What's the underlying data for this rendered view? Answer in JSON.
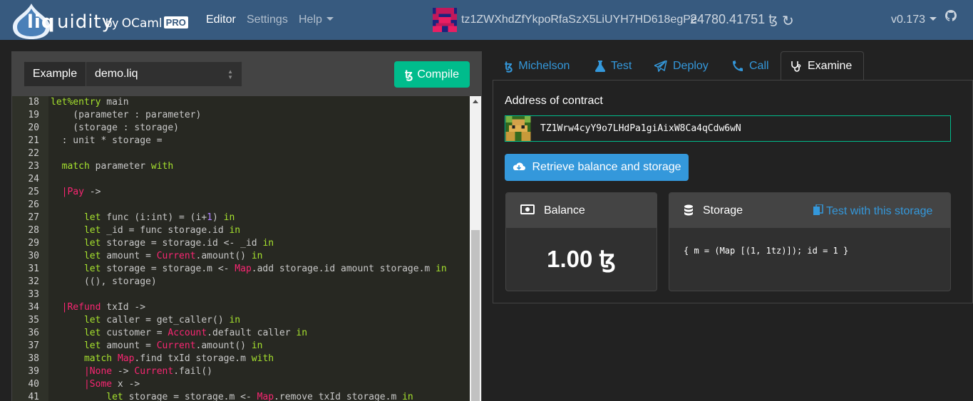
{
  "navbar": {
    "brand_liq": "liq",
    "brand_rest": "uidity",
    "brand_by": "by",
    "brand_ocaml": "OCaml",
    "brand_pro": "PRO",
    "links": [
      "Editor",
      "Settings",
      "Help"
    ],
    "account_address": "tz1ZWXhdZfYkpoRfaSzX5LiUYH7HD618egPe",
    "account_balance": "24780.41751 ꜩ",
    "version": "v0.173",
    "icons": [
      "refresh-icon",
      "github-icon",
      "account-identicon"
    ]
  },
  "editor": {
    "example_label": "Example",
    "example_file": "demo.liq",
    "compile_label": "Compile",
    "lines": [
      {
        "n": "18",
        "html": "<span class=\"kw\">let%entry</span> main"
      },
      {
        "n": "19",
        "html": "    (parameter : parameter)"
      },
      {
        "n": "20",
        "html": "    (storage : storage)"
      },
      {
        "n": "21",
        "html": "  : unit * storage ="
      },
      {
        "n": "22",
        "html": ""
      },
      {
        "n": "23",
        "html": "  <span class=\"kw\">match</span> parameter <span class=\"kw\">with</span>"
      },
      {
        "n": "24",
        "html": ""
      },
      {
        "n": "25",
        "html": "  <span class=\"bar\">|</span><span class=\"md\">Pay</span> ->"
      },
      {
        "n": "26",
        "html": ""
      },
      {
        "n": "27",
        "html": "      <span class=\"kw\">let</span> func (i:int) = (i+<span class=\"nm\">1</span>) <span class=\"kw\">in</span>"
      },
      {
        "n": "28",
        "html": "      <span class=\"kw\">let</span> _id = func storage.id <span class=\"kw\">in</span>"
      },
      {
        "n": "29",
        "html": "      <span class=\"kw\">let</span> storage = storage.id <- _id <span class=\"kw\">in</span>"
      },
      {
        "n": "30",
        "html": "      <span class=\"kw\">let</span> amount = <span class=\"md\">Current</span>.amount() <span class=\"kw\">in</span>"
      },
      {
        "n": "31",
        "html": "      <span class=\"kw\">let</span> storage = storage.m <- <span class=\"md\">Map</span>.add storage.id amount storage.m <span class=\"kw\">in</span>"
      },
      {
        "n": "32",
        "html": "      ((), storage)"
      },
      {
        "n": "33",
        "html": ""
      },
      {
        "n": "34",
        "html": "  <span class=\"bar\">|</span><span class=\"md\">Refund</span> txId ->"
      },
      {
        "n": "35",
        "html": "      <span class=\"kw\">let</span> caller = get_caller() <span class=\"kw\">in</span>"
      },
      {
        "n": "36",
        "html": "      <span class=\"kw\">let</span> customer = <span class=\"md\">Account</span>.default caller <span class=\"kw\">in</span>"
      },
      {
        "n": "37",
        "html": "      <span class=\"kw\">let</span> amount = <span class=\"md\">Current</span>.amount() <span class=\"kw\">in</span>"
      },
      {
        "n": "38",
        "html": "      <span class=\"kw\">match</span> <span class=\"md\">Map</span>.find txId storage.m <span class=\"kw\">with</span>"
      },
      {
        "n": "39",
        "html": "      <span class=\"bar\">|</span><span class=\"md\">None</span> -> <span class=\"md\">Current</span>.fail()"
      },
      {
        "n": "40",
        "html": "      <span class=\"bar\">|</span><span class=\"md\">Some</span> x ->"
      },
      {
        "n": "41",
        "html": "          <span class=\"kw\">let</span> storage = storage.m <- <span class=\"md\">Map</span>.remove txId storage.m <span class=\"kw\">in</span>"
      }
    ]
  },
  "tabs": [
    {
      "label": "Michelson",
      "icon": "tezos-icon"
    },
    {
      "label": "Test",
      "icon": "flask-icon"
    },
    {
      "label": "Deploy",
      "icon": "paper-plane-icon"
    },
    {
      "label": "Call",
      "icon": "phone-icon"
    },
    {
      "label": "Examine",
      "icon": "stethoscope-icon"
    }
  ],
  "examine": {
    "address_label": "Address of contract",
    "address_value": "TZ1Wrw4cyY9o7LHdPa1giAixW8Ca4qCdw6wN",
    "retrieve_label": "Retrieve balance and storage",
    "balance_title": "Balance",
    "balance_value": "1.00 ꜩ",
    "storage_title": "Storage",
    "test_storage_label": "Test with this storage",
    "storage_value": "{ m = (Map [(1, 1tz)]); id = 1 }"
  },
  "colors": {
    "navbar": "#375a7f",
    "primary": "#3498db",
    "success": "#00bc8c",
    "background": "#222222"
  }
}
